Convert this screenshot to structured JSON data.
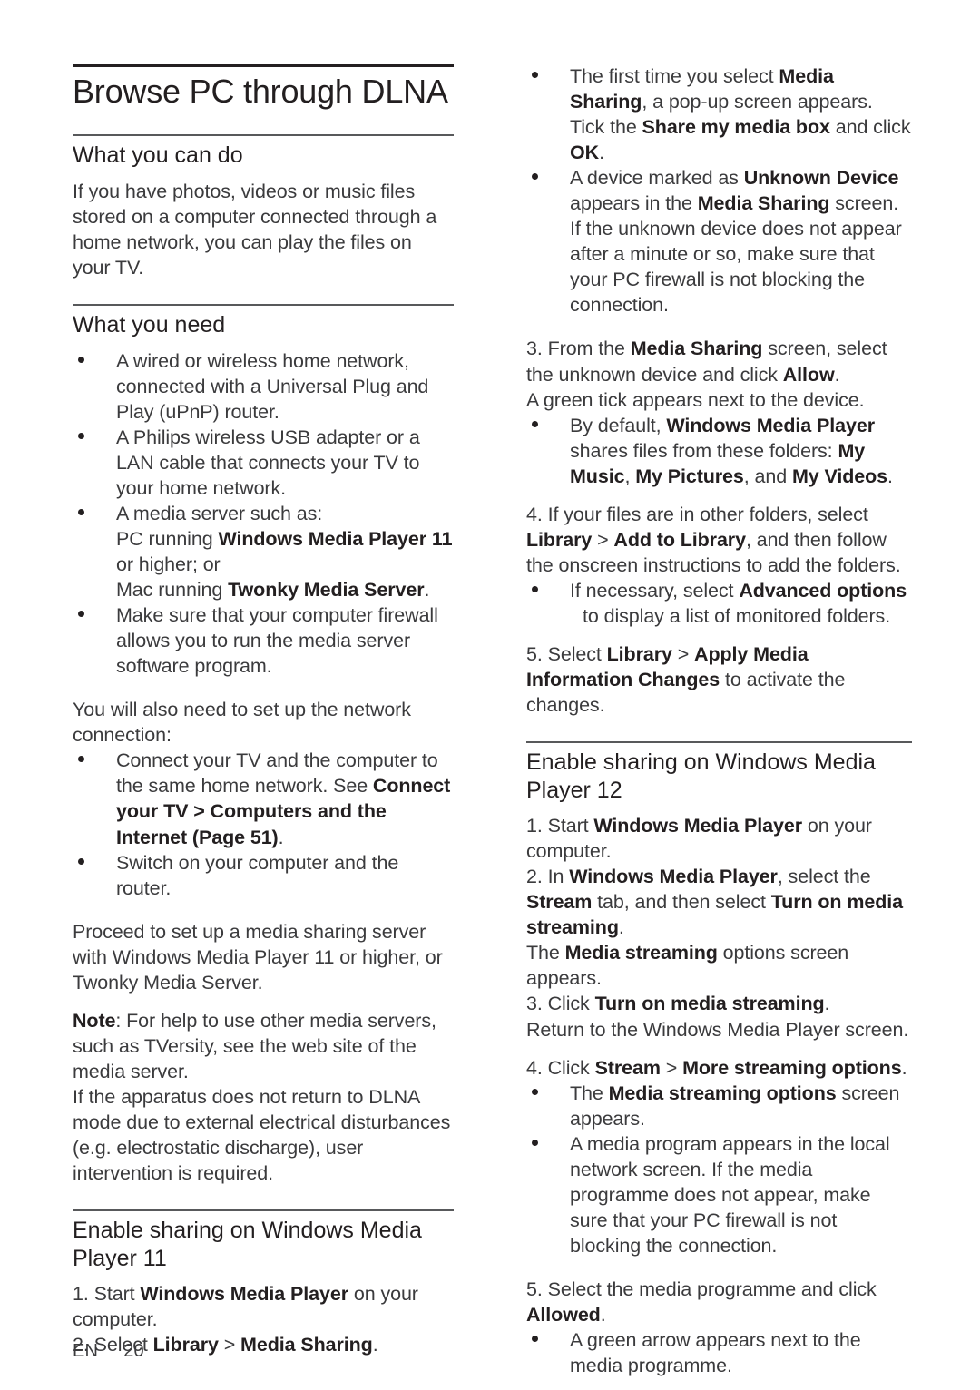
{
  "document": {
    "title": "Browse PC through DLNA",
    "footer": {
      "language": "EN",
      "page_number": "20"
    }
  },
  "left_column": {
    "section_what_you_can_do": {
      "heading": "What you can do",
      "paragraph": "If you have photos, videos or music files stored on a computer connected through a home network, you can play the files on your TV."
    },
    "section_what_you_need": {
      "heading": "What you need",
      "bullets": [
        {
          "plain1": "A wired or wireless home network, connected with a Universal Plug and Play (uPnP) router."
        },
        {
          "plain1": "A Philips wireless USB adapter or a LAN cable that connects your TV to your home network."
        },
        {
          "plain1": "A media server such as:",
          "line2_pre": "PC running ",
          "line2_bold": "Windows Media Player 11",
          "line2_post": " or higher; or",
          "line3_pre": "Mac running ",
          "line3_bold": "Twonky Media Server",
          "line3_post": "."
        },
        {
          "plain1": "Make sure that your computer firewall allows you to run the media server software program."
        }
      ],
      "network_intro": "You will also need to set up the network connection:",
      "network_bullets": [
        {
          "pre": "Connect your TV and the computer to the same home network. See ",
          "bold": "Connect your TV > Computers and the Internet (Page 51)",
          "post": "."
        },
        {
          "pre": "Switch on your computer and the router.",
          "bold": "",
          "post": ""
        }
      ],
      "proceed_paragraph": "Proceed to set up a media sharing server with Windows Media Player 11 or higher, or Twonky Media Server.",
      "note_label": "Note",
      "note_text": ": For help to use other media servers, such as TVersity, see the web site of the media server.",
      "apparatus_text": "If the apparatus does not return to DLNA mode due to external electrical disturbances (e.g. electrostatic discharge), user intervention is required."
    },
    "section_wmp11": {
      "heading": "Enable sharing on Windows Media Player 11",
      "step1_pre": "1. Start ",
      "step1_bold": "Windows Media Player",
      "step1_post": " on your computer.",
      "step2_pre": "2. Select ",
      "step2_bold1": "Library",
      "step2_mid": " > ",
      "step2_bold2": "Media Sharing",
      "step2_post": "."
    }
  },
  "right_column": {
    "wmp11_bullets": [
      {
        "pre": "The first time you select ",
        "bold1": "Media Sharing",
        "mid1": ", a pop-up screen appears. Tick the ",
        "bold2": "Share my media box",
        "mid2": " and click ",
        "bold3": "OK",
        "post": "."
      },
      {
        "pre": "A device marked as ",
        "bold1": "Unknown Device",
        "mid1": " appears in the ",
        "bold2": "Media Sharing",
        "post": " screen. If the unknown device does not appear after a minute or so, make sure that your PC firewall is not blocking the connection."
      }
    ],
    "step3_pre": "3. From the ",
    "step3_bold1": "Media Sharing",
    "step3_mid": " screen, select the unknown device and click ",
    "step3_bold2": "Allow",
    "step3_post": ".",
    "step3_note": "A green tick appears next to the device.",
    "default_folders_bullet": {
      "pre": "By default, ",
      "bold1": "Windows Media Player",
      "mid1": " shares files from these folders: ",
      "bold2": "My Music",
      "mid2": ", ",
      "bold3": "My Pictures",
      "mid3": ", and ",
      "bold4": "My Videos",
      "post": "."
    },
    "step4_pre": "4. If your files are in other folders, select ",
    "step4_bold1": "Library",
    "step4_mid": " > ",
    "step4_bold2": "Add to Library",
    "step4_post": ", and then follow the onscreen instructions to add the folders.",
    "advanced_bullet": {
      "pre": "If necessary, select ",
      "bold1": "Advanced options",
      "post": " to display a list of monitored folders."
    },
    "step5_pre": "5. Select ",
    "step5_bold1": "Library",
    "step5_mid": " > ",
    "step5_bold2": "Apply Media Information Changes",
    "step5_post": " to activate the changes.",
    "section_wmp12": {
      "heading": "Enable sharing on Windows Media Player 12",
      "step1_pre": "1. Start ",
      "step1_bold": "Windows Media Player",
      "step1_post": " on your computer.",
      "step2_pre": "2. In ",
      "step2_bold1": "Windows Media Player",
      "step2_mid1": ", select the ",
      "step2_bold2": "Stream",
      "step2_mid2": " tab, and then select ",
      "step2_bold3": "Turn on media streaming",
      "step2_post": ".",
      "step2_note_pre": "The ",
      "step2_note_bold": "Media streaming",
      "step2_note_post": " options screen appears.",
      "step3_pre": "3. Click ",
      "step3_bold": "Turn on media streaming",
      "step3_post": ".",
      "step3_note": "Return to the Windows Media Player screen.",
      "step4_pre": "4. Click ",
      "step4_bold1": "Stream",
      "step4_mid": " > ",
      "step4_bold2": "More streaming options",
      "step4_post": ".",
      "bullets": [
        {
          "pre": "The ",
          "bold1": "Media streaming options",
          "post": " screen appears."
        },
        {
          "pre": "A media program appears in the local network screen. If the media programme does not appear, make sure that your PC firewall is not blocking the connection.",
          "bold1": "",
          "post": ""
        }
      ],
      "step5_pre": "5. Select the media programme and click ",
      "step5_bold": "Allowed",
      "step5_post": ".",
      "step5_bullet": "A green arrow appears next to the media programme."
    }
  }
}
